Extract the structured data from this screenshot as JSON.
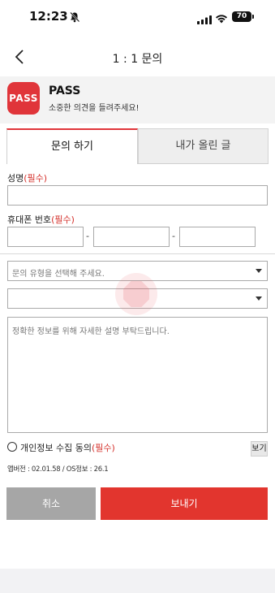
{
  "status_bar": {
    "time": "12:23",
    "battery": "70"
  },
  "nav": {
    "title": "1 : 1 문의"
  },
  "app": {
    "logo_text": "PASS",
    "name": "PASS",
    "subtitle": "소중한 의견을 들려주세요!"
  },
  "tabs": [
    {
      "label": "문의 하기",
      "active": true
    },
    {
      "label": "내가 올린 글",
      "active": false
    }
  ],
  "form": {
    "name_label": "성명",
    "name_required": "(필수)",
    "name_value": "",
    "phone_label": "휴대폰 번호",
    "phone_required": "(필수)",
    "phone_parts": [
      "",
      "",
      ""
    ],
    "phone_separator": "-",
    "inquiry_type_placeholder": "문의 유형을 선택해 주세요.",
    "inquiry_subtype_value": "",
    "detail_placeholder": "정확한 정보를 위해 자세한 설명 부탁드립니다.",
    "consent_label": "개인정보 수집 동의",
    "consent_required": "(필수)",
    "consent_checked": false,
    "view_label": "보기",
    "version_info": "앱버전 : 02.01.58 / OS정보 : 26.1"
  },
  "buttons": {
    "cancel": "취소",
    "send": "보내기"
  },
  "colors": {
    "accent": "#e0353a",
    "cancel": "#a6a6a6",
    "send": "#e2352e"
  }
}
